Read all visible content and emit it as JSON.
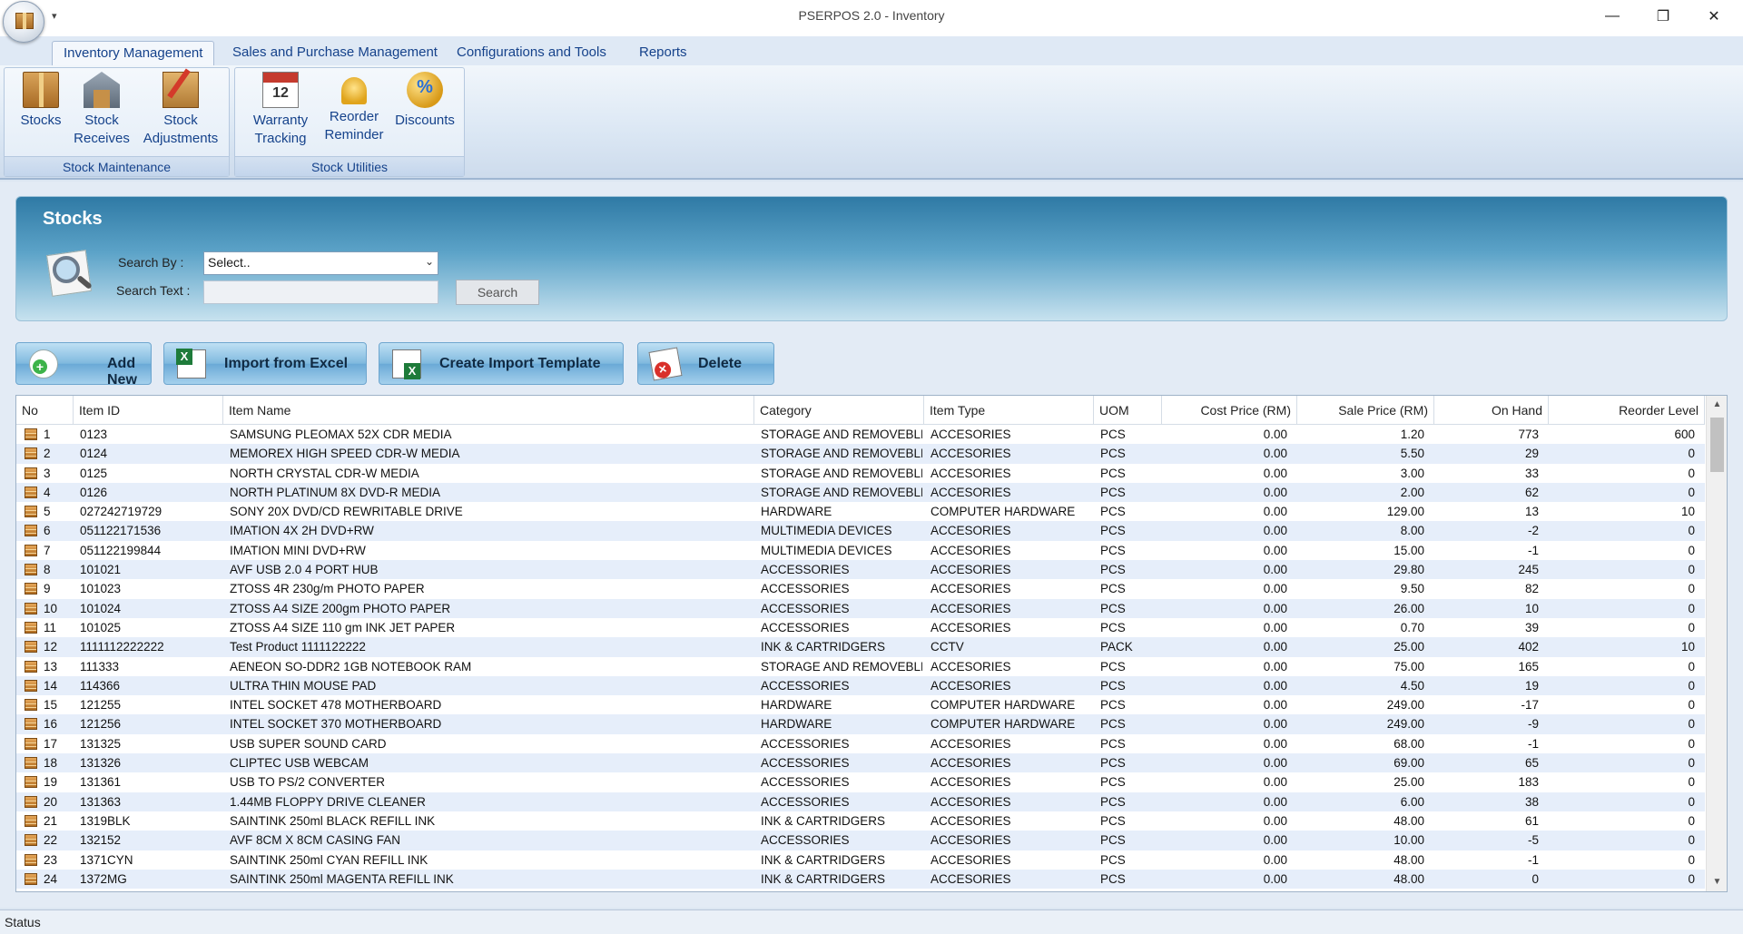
{
  "window": {
    "title": "PSERPOS 2.0 - Inventory",
    "qat_glyph": "▾",
    "minimize": "—",
    "restore": "❐",
    "close": "✕"
  },
  "ribbon": {
    "tabs": [
      "Inventory Management",
      "Sales and Purchase Management",
      "Configurations and Tools",
      "Reports"
    ],
    "groups": {
      "stock_maintenance": {
        "label": "Stock Maintenance",
        "buttons": [
          {
            "line1": "Stocks",
            "line2": "",
            "icon": "box-icon"
          },
          {
            "line1": "Stock",
            "line2": "Receives",
            "icon": "warehouse-icon"
          },
          {
            "line1": "Stock",
            "line2": "Adjustments",
            "icon": "box-pencil-icon"
          }
        ]
      },
      "stock_utilities": {
        "label": "Stock Utilities",
        "buttons": [
          {
            "line1": "Warranty",
            "line2": "Tracking",
            "icon": "calendar-icon"
          },
          {
            "line1": "Reorder",
            "line2": "Reminder",
            "icon": "bell-icon"
          },
          {
            "line1": "Discounts",
            "line2": "",
            "icon": "coins-icon"
          }
        ]
      }
    }
  },
  "panel": {
    "title": "Stocks",
    "search_by_label": "Search By :",
    "search_by_value": "Select..",
    "search_text_label": "Search Text :",
    "search_text_value": "",
    "search_button": "Search"
  },
  "actions": {
    "add_new": "Add New",
    "import_excel": "Import from Excel",
    "create_template": "Create Import Template",
    "delete": "Delete"
  },
  "grid": {
    "columns": [
      "No",
      "Item ID",
      "Item Name",
      "Category",
      "Item Type",
      "UOM",
      "Cost Price (RM)",
      "Sale Price (RM)",
      "On Hand",
      "Reorder Level"
    ],
    "rows": [
      [
        "1",
        "0123",
        "SAMSUNG PLEOMAX 52X CDR MEDIA",
        "STORAGE AND REMOVEBLE",
        "ACCESORIES",
        "PCS",
        "0.00",
        "1.20",
        "773",
        "600"
      ],
      [
        "2",
        "0124",
        "MEMOREX HIGH SPEED CDR-W MEDIA",
        "STORAGE AND REMOVEBLE",
        "ACCESORIES",
        "PCS",
        "0.00",
        "5.50",
        "29",
        "0"
      ],
      [
        "3",
        "0125",
        "NORTH CRYSTAL CDR-W MEDIA",
        "STORAGE AND REMOVEBLE",
        "ACCESORIES",
        "PCS",
        "0.00",
        "3.00",
        "33",
        "0"
      ],
      [
        "4",
        "0126",
        "NORTH PLATINUM 8X DVD-R MEDIA",
        "STORAGE AND REMOVEBLE",
        "ACCESORIES",
        "PCS",
        "0.00",
        "2.00",
        "62",
        "0"
      ],
      [
        "5",
        "027242719729",
        "SONY 20X DVD/CD REWRITABLE  DRIVE",
        "HARDWARE",
        "COMPUTER HARDWARE",
        "PCS",
        "0.00",
        "129.00",
        "13",
        "10"
      ],
      [
        "6",
        "051122171536",
        "IMATION 4X 2H DVD+RW",
        "MULTIMEDIA DEVICES",
        "ACCESORIES",
        "PCS",
        "0.00",
        "8.00",
        "-2",
        "0"
      ],
      [
        "7",
        "051122199844",
        "IMATION MINI DVD+RW",
        "MULTIMEDIA DEVICES",
        "ACCESORIES",
        "PCS",
        "0.00",
        "15.00",
        "-1",
        "0"
      ],
      [
        "8",
        "101021",
        "AVF USB 2.0 4 PORT HUB",
        "ACCESSORIES",
        "ACCESORIES",
        "PCS",
        "0.00",
        "29.80",
        "245",
        "0"
      ],
      [
        "9",
        "101023",
        "ZTOSS 4R 230g/m PHOTO PAPER",
        "ACCESSORIES",
        "ACCESORIES",
        "PCS",
        "0.00",
        "9.50",
        "82",
        "0"
      ],
      [
        "10",
        "101024",
        "ZTOSS A4 SIZE 200gm PHOTO PAPER",
        "ACCESSORIES",
        "ACCESORIES",
        "PCS",
        "0.00",
        "26.00",
        "10",
        "0"
      ],
      [
        "11",
        "101025",
        "ZTOSS A4 SIZE 110 gm INK JET PAPER",
        "ACCESSORIES",
        "ACCESORIES",
        "PCS",
        "0.00",
        "0.70",
        "39",
        "0"
      ],
      [
        "12",
        "1111112222222",
        "Test Product 1111122222",
        "INK & CARTRIDGERS",
        "CCTV",
        "PACK",
        "0.00",
        "25.00",
        "402",
        "10"
      ],
      [
        "13",
        "111333",
        "AENEON SO-DDR2 1GB NOTEBOOK RAM",
        "STORAGE AND REMOVEBLE",
        "ACCESORIES",
        "PCS",
        "0.00",
        "75.00",
        "165",
        "0"
      ],
      [
        "14",
        "114366",
        "ULTRA THIN MOUSE PAD",
        "ACCESSORIES",
        "ACCESORIES",
        "PCS",
        "0.00",
        "4.50",
        "19",
        "0"
      ],
      [
        "15",
        "121255",
        "INTEL SOCKET 478 MOTHERBOARD",
        "HARDWARE",
        "COMPUTER HARDWARE",
        "PCS",
        "0.00",
        "249.00",
        "-17",
        "0"
      ],
      [
        "16",
        "121256",
        "INTEL SOCKET 370 MOTHERBOARD",
        "HARDWARE",
        "COMPUTER HARDWARE",
        "PCS",
        "0.00",
        "249.00",
        "-9",
        "0"
      ],
      [
        "17",
        "131325",
        "USB SUPER SOUND CARD",
        "ACCESSORIES",
        "ACCESORIES",
        "PCS",
        "0.00",
        "68.00",
        "-1",
        "0"
      ],
      [
        "18",
        "131326",
        "CLIPTEC USB WEBCAM",
        "ACCESSORIES",
        "ACCESORIES",
        "PCS",
        "0.00",
        "69.00",
        "65",
        "0"
      ],
      [
        "19",
        "131361",
        "USB TO PS/2 CONVERTER",
        "ACCESSORIES",
        "ACCESORIES",
        "PCS",
        "0.00",
        "25.00",
        "183",
        "0"
      ],
      [
        "20",
        "131363",
        "1.44MB FLOPPY DRIVE CLEANER",
        "ACCESSORIES",
        "ACCESORIES",
        "PCS",
        "0.00",
        "6.00",
        "38",
        "0"
      ],
      [
        "21",
        "1319BLK",
        "SAINTINK 250ml BLACK REFILL INK",
        "INK & CARTRIDGERS",
        "ACCESORIES",
        "PCS",
        "0.00",
        "48.00",
        "61",
        "0"
      ],
      [
        "22",
        "132152",
        "AVF 8CM X 8CM CASING FAN",
        "ACCESSORIES",
        "ACCESORIES",
        "PCS",
        "0.00",
        "10.00",
        "-5",
        "0"
      ],
      [
        "23",
        "1371CYN",
        "SAINTINK 250ml CYAN REFILL INK",
        "INK & CARTRIDGERS",
        "ACCESORIES",
        "PCS",
        "0.00",
        "48.00",
        "-1",
        "0"
      ],
      [
        "24",
        "1372MG",
        "SAINTINK 250ml MAGENTA REFILL INK",
        "INK & CARTRIDGERS",
        "ACCESORIES",
        "PCS",
        "0.00",
        "48.00",
        "0",
        "0"
      ]
    ]
  },
  "status": "Status"
}
